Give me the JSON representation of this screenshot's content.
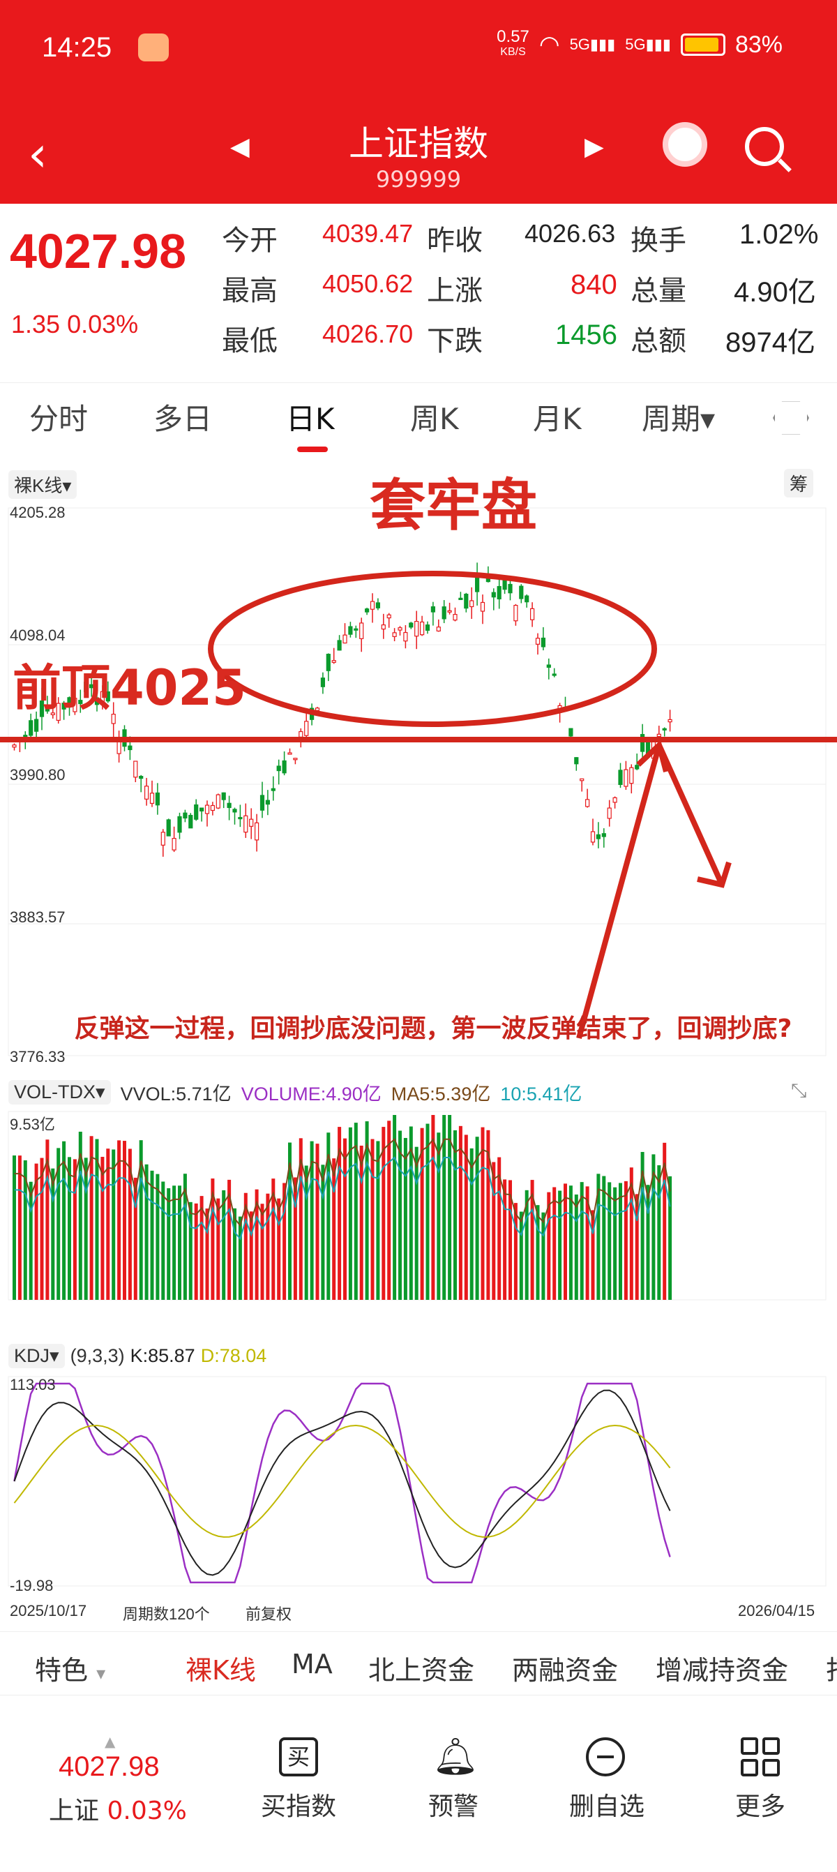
{
  "status": {
    "time": "14:25",
    "speed": "0.57",
    "speed_unit": "KB/S",
    "battery": "83%",
    "net1": "5G",
    "net2": "5G"
  },
  "nav": {
    "title": "上证指数",
    "code": "999999"
  },
  "quote": {
    "price": "4027.98",
    "change": "1.35 0.03%",
    "open_label": "今开",
    "open": "4039.47",
    "prev_label": "昨收",
    "prev": "4026.63",
    "turnover_label": "换手",
    "turnover": "1.02%",
    "high_label": "最高",
    "high": "4050.62",
    "up_label": "上涨",
    "up": "840",
    "vol_label": "总量",
    "vol": "4.90亿",
    "low_label": "最低",
    "low": "4026.70",
    "down_label": "下跌",
    "down": "1456",
    "amount_label": "总额",
    "amount": "8974亿"
  },
  "tabs": [
    "分时",
    "多日",
    "日K",
    "周K",
    "月K",
    "周期▾"
  ],
  "kline": {
    "mode": "裸K线",
    "chou": "筹",
    "y_labels": [
      "4205.28",
      "4098.04",
      "3990.80",
      "3883.57",
      "3776.33"
    ],
    "annotation_title": "套牢盘",
    "annotation_top": "前顶4025",
    "annotation_note": "反弹这一过程，回调抄底没问题，第一波反弹结束了，回调抄底?"
  },
  "volume": {
    "label": "VOL-TDX",
    "vvol": "VVOL:5.71亿",
    "volume": "VOLUME:4.90亿",
    "ma5": "MA5:5.39亿",
    "ma10": "10:5.41亿",
    "ymax": "9.53亿"
  },
  "kdj": {
    "label": "KDJ",
    "params": "(9,3,3)",
    "k": "K:85.87",
    "d": "D:78.04",
    "ymax": "113.03",
    "ymin": "-19.98"
  },
  "footer_axis": {
    "start": "2025/10/17",
    "count": "周期数120个",
    "adj": "前复权",
    "end": "2026/04/15"
  },
  "subtabs": [
    "特色",
    "裸K线",
    "MA",
    "北上资金",
    "两融资金",
    "增减持资金",
    "打"
  ],
  "bottom": {
    "price": "4027.98",
    "sub_label": "上证",
    "sub_pct": "0.03%",
    "buy_icon_char": "买",
    "items": [
      "买指数",
      "预警",
      "删自选",
      "更多"
    ]
  },
  "colors": {
    "up": "#e8191c",
    "down": "#0b9a2c",
    "header": "#e8191c",
    "annotation": "#d92a20"
  }
}
